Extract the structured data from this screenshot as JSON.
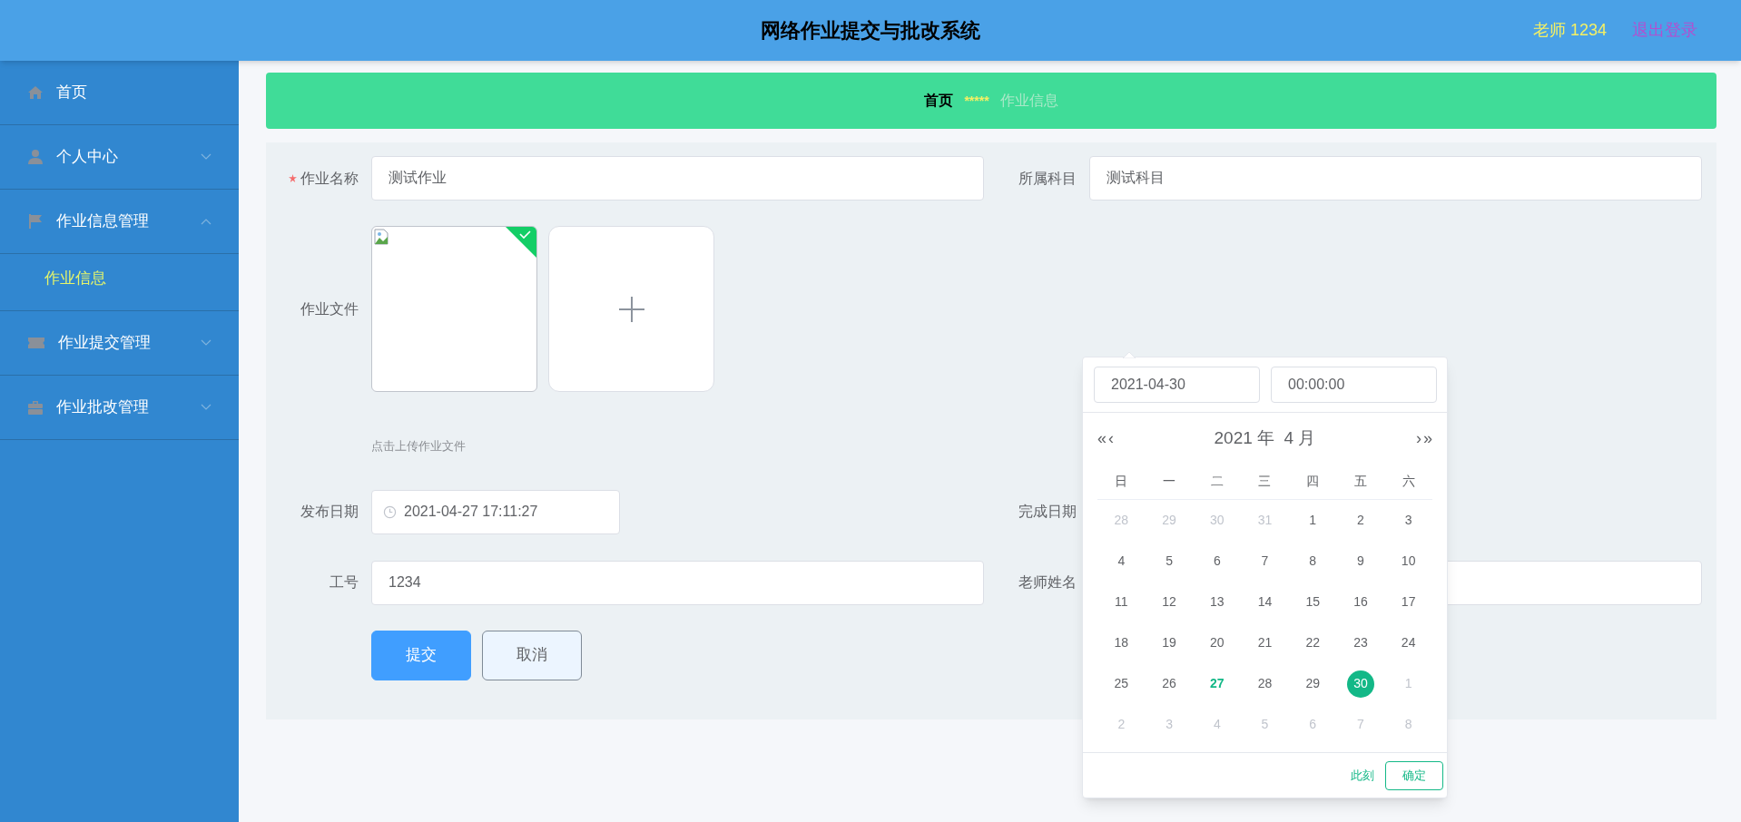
{
  "header": {
    "title": "网络作业提交与批改系统",
    "user": "老师 1234",
    "logout": "退出登录"
  },
  "sidebar": {
    "items": [
      {
        "label": "首页",
        "selected": false
      },
      {
        "label": "个人中心",
        "selected": false,
        "expanded": false
      },
      {
        "label": "作业信息管理",
        "selected": false,
        "expanded": true,
        "children": [
          {
            "label": "作业信息",
            "selected": true
          }
        ]
      },
      {
        "label": "作业提交管理",
        "selected": false,
        "expanded": false
      },
      {
        "label": "作业批改管理",
        "selected": false,
        "expanded": false
      }
    ]
  },
  "breadcrumb": {
    "home": "首页",
    "separator": "*****",
    "current": "作业信息"
  },
  "form": {
    "name": {
      "label": "作业名称",
      "required": true,
      "value": "测试作业"
    },
    "subject": {
      "label": "所属科目",
      "value": "测试科目"
    },
    "file": {
      "label": "作业文件",
      "files": [
        {
          "success": true
        }
      ],
      "hint": "点击上传作业文件"
    },
    "publish_date": {
      "label": "发布日期",
      "value": "2021-04-27 17:11:27"
    },
    "finish_date": {
      "label": "完成日期"
    },
    "teacher_id": {
      "label": "工号",
      "value": "1234"
    },
    "teacher_name": {
      "label": "老师姓名"
    },
    "buttons": [
      {
        "label": "提交",
        "kind": "primary"
      },
      {
        "label": "取消",
        "kind": "secondary"
      }
    ]
  },
  "date_picker": {
    "date": "2021-04-30",
    "time": "00:00:00",
    "title": "2021 年  4 月",
    "prev_year": "«",
    "prev_month": "‹",
    "next_month": "›",
    "next_year": "»",
    "weekdays": [
      "日",
      "一",
      "二",
      "三",
      "四",
      "五",
      "六"
    ],
    "days": [
      {
        "label": "28",
        "kind": "other",
        "selected": false,
        "today": false
      },
      {
        "label": "29",
        "kind": "other",
        "selected": false,
        "today": false
      },
      {
        "label": "30",
        "kind": "other",
        "selected": false,
        "today": false
      },
      {
        "label": "31",
        "kind": "other",
        "selected": false,
        "today": false
      },
      {
        "label": "1",
        "kind": "current",
        "selected": false,
        "today": false
      },
      {
        "label": "2",
        "kind": "current",
        "selected": false,
        "today": false
      },
      {
        "label": "3",
        "kind": "current",
        "selected": false,
        "today": false
      },
      {
        "label": "4",
        "kind": "current",
        "selected": false,
        "today": false
      },
      {
        "label": "5",
        "kind": "current",
        "selected": false,
        "today": false
      },
      {
        "label": "6",
        "kind": "current",
        "selected": false,
        "today": false
      },
      {
        "label": "7",
        "kind": "current",
        "selected": false,
        "today": false
      },
      {
        "label": "8",
        "kind": "current",
        "selected": false,
        "today": false
      },
      {
        "label": "9",
        "kind": "current",
        "selected": false,
        "today": false
      },
      {
        "label": "10",
        "kind": "current",
        "selected": false,
        "today": false
      },
      {
        "label": "11",
        "kind": "current",
        "selected": false,
        "today": false
      },
      {
        "label": "12",
        "kind": "current",
        "selected": false,
        "today": false
      },
      {
        "label": "13",
        "kind": "current",
        "selected": false,
        "today": false
      },
      {
        "label": "14",
        "kind": "current",
        "selected": false,
        "today": false
      },
      {
        "label": "15",
        "kind": "current",
        "selected": false,
        "today": false
      },
      {
        "label": "16",
        "kind": "current",
        "selected": false,
        "today": false
      },
      {
        "label": "17",
        "kind": "current",
        "selected": false,
        "today": false
      },
      {
        "label": "18",
        "kind": "current",
        "selected": false,
        "today": false
      },
      {
        "label": "19",
        "kind": "current",
        "selected": false,
        "today": false
      },
      {
        "label": "20",
        "kind": "current",
        "selected": false,
        "today": false
      },
      {
        "label": "21",
        "kind": "current",
        "selected": false,
        "today": false
      },
      {
        "label": "22",
        "kind": "current",
        "selected": false,
        "today": false
      },
      {
        "label": "23",
        "kind": "current",
        "selected": false,
        "today": false
      },
      {
        "label": "24",
        "kind": "current",
        "selected": false,
        "today": false
      },
      {
        "label": "25",
        "kind": "current",
        "selected": false,
        "today": false
      },
      {
        "label": "26",
        "kind": "current",
        "selected": false,
        "today": false
      },
      {
        "label": "27",
        "kind": "current",
        "selected": false,
        "today": true
      },
      {
        "label": "28",
        "kind": "current",
        "selected": false,
        "today": false
      },
      {
        "label": "29",
        "kind": "current",
        "selected": false,
        "today": false
      },
      {
        "label": "30",
        "kind": "current",
        "selected": true,
        "today": false
      },
      {
        "label": "1",
        "kind": "other",
        "selected": false,
        "today": false
      },
      {
        "label": "2",
        "kind": "other",
        "selected": false,
        "today": false
      },
      {
        "label": "3",
        "kind": "other",
        "selected": false,
        "today": false
      },
      {
        "label": "4",
        "kind": "other",
        "selected": false,
        "today": false
      },
      {
        "label": "5",
        "kind": "other",
        "selected": false,
        "today": false
      },
      {
        "label": "6",
        "kind": "other",
        "selected": false,
        "today": false
      },
      {
        "label": "7",
        "kind": "other",
        "selected": false,
        "today": false
      },
      {
        "label": "8",
        "kind": "other",
        "selected": false,
        "today": false
      }
    ],
    "now": "此刻",
    "confirm": "确定"
  }
}
